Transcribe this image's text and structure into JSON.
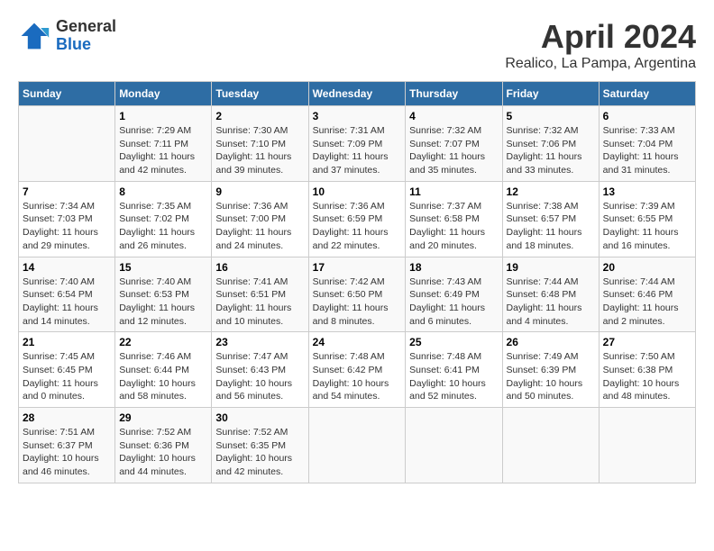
{
  "header": {
    "logo_general": "General",
    "logo_blue": "Blue",
    "title": "April 2024",
    "subtitle": "Realico, La Pampa, Argentina"
  },
  "calendar": {
    "days_of_week": [
      "Sunday",
      "Monday",
      "Tuesday",
      "Wednesday",
      "Thursday",
      "Friday",
      "Saturday"
    ],
    "weeks": [
      [
        {
          "day": "",
          "info": ""
        },
        {
          "day": "1",
          "info": "Sunrise: 7:29 AM\nSunset: 7:11 PM\nDaylight: 11 hours\nand 42 minutes."
        },
        {
          "day": "2",
          "info": "Sunrise: 7:30 AM\nSunset: 7:10 PM\nDaylight: 11 hours\nand 39 minutes."
        },
        {
          "day": "3",
          "info": "Sunrise: 7:31 AM\nSunset: 7:09 PM\nDaylight: 11 hours\nand 37 minutes."
        },
        {
          "day": "4",
          "info": "Sunrise: 7:32 AM\nSunset: 7:07 PM\nDaylight: 11 hours\nand 35 minutes."
        },
        {
          "day": "5",
          "info": "Sunrise: 7:32 AM\nSunset: 7:06 PM\nDaylight: 11 hours\nand 33 minutes."
        },
        {
          "day": "6",
          "info": "Sunrise: 7:33 AM\nSunset: 7:04 PM\nDaylight: 11 hours\nand 31 minutes."
        }
      ],
      [
        {
          "day": "7",
          "info": "Sunrise: 7:34 AM\nSunset: 7:03 PM\nDaylight: 11 hours\nand 29 minutes."
        },
        {
          "day": "8",
          "info": "Sunrise: 7:35 AM\nSunset: 7:02 PM\nDaylight: 11 hours\nand 26 minutes."
        },
        {
          "day": "9",
          "info": "Sunrise: 7:36 AM\nSunset: 7:00 PM\nDaylight: 11 hours\nand 24 minutes."
        },
        {
          "day": "10",
          "info": "Sunrise: 7:36 AM\nSunset: 6:59 PM\nDaylight: 11 hours\nand 22 minutes."
        },
        {
          "day": "11",
          "info": "Sunrise: 7:37 AM\nSunset: 6:58 PM\nDaylight: 11 hours\nand 20 minutes."
        },
        {
          "day": "12",
          "info": "Sunrise: 7:38 AM\nSunset: 6:57 PM\nDaylight: 11 hours\nand 18 minutes."
        },
        {
          "day": "13",
          "info": "Sunrise: 7:39 AM\nSunset: 6:55 PM\nDaylight: 11 hours\nand 16 minutes."
        }
      ],
      [
        {
          "day": "14",
          "info": "Sunrise: 7:40 AM\nSunset: 6:54 PM\nDaylight: 11 hours\nand 14 minutes."
        },
        {
          "day": "15",
          "info": "Sunrise: 7:40 AM\nSunset: 6:53 PM\nDaylight: 11 hours\nand 12 minutes."
        },
        {
          "day": "16",
          "info": "Sunrise: 7:41 AM\nSunset: 6:51 PM\nDaylight: 11 hours\nand 10 minutes."
        },
        {
          "day": "17",
          "info": "Sunrise: 7:42 AM\nSunset: 6:50 PM\nDaylight: 11 hours\nand 8 minutes."
        },
        {
          "day": "18",
          "info": "Sunrise: 7:43 AM\nSunset: 6:49 PM\nDaylight: 11 hours\nand 6 minutes."
        },
        {
          "day": "19",
          "info": "Sunrise: 7:44 AM\nSunset: 6:48 PM\nDaylight: 11 hours\nand 4 minutes."
        },
        {
          "day": "20",
          "info": "Sunrise: 7:44 AM\nSunset: 6:46 PM\nDaylight: 11 hours\nand 2 minutes."
        }
      ],
      [
        {
          "day": "21",
          "info": "Sunrise: 7:45 AM\nSunset: 6:45 PM\nDaylight: 11 hours\nand 0 minutes."
        },
        {
          "day": "22",
          "info": "Sunrise: 7:46 AM\nSunset: 6:44 PM\nDaylight: 10 hours\nand 58 minutes."
        },
        {
          "day": "23",
          "info": "Sunrise: 7:47 AM\nSunset: 6:43 PM\nDaylight: 10 hours\nand 56 minutes."
        },
        {
          "day": "24",
          "info": "Sunrise: 7:48 AM\nSunset: 6:42 PM\nDaylight: 10 hours\nand 54 minutes."
        },
        {
          "day": "25",
          "info": "Sunrise: 7:48 AM\nSunset: 6:41 PM\nDaylight: 10 hours\nand 52 minutes."
        },
        {
          "day": "26",
          "info": "Sunrise: 7:49 AM\nSunset: 6:39 PM\nDaylight: 10 hours\nand 50 minutes."
        },
        {
          "day": "27",
          "info": "Sunrise: 7:50 AM\nSunset: 6:38 PM\nDaylight: 10 hours\nand 48 minutes."
        }
      ],
      [
        {
          "day": "28",
          "info": "Sunrise: 7:51 AM\nSunset: 6:37 PM\nDaylight: 10 hours\nand 46 minutes."
        },
        {
          "day": "29",
          "info": "Sunrise: 7:52 AM\nSunset: 6:36 PM\nDaylight: 10 hours\nand 44 minutes."
        },
        {
          "day": "30",
          "info": "Sunrise: 7:52 AM\nSunset: 6:35 PM\nDaylight: 10 hours\nand 42 minutes."
        },
        {
          "day": "",
          "info": ""
        },
        {
          "day": "",
          "info": ""
        },
        {
          "day": "",
          "info": ""
        },
        {
          "day": "",
          "info": ""
        }
      ]
    ]
  }
}
